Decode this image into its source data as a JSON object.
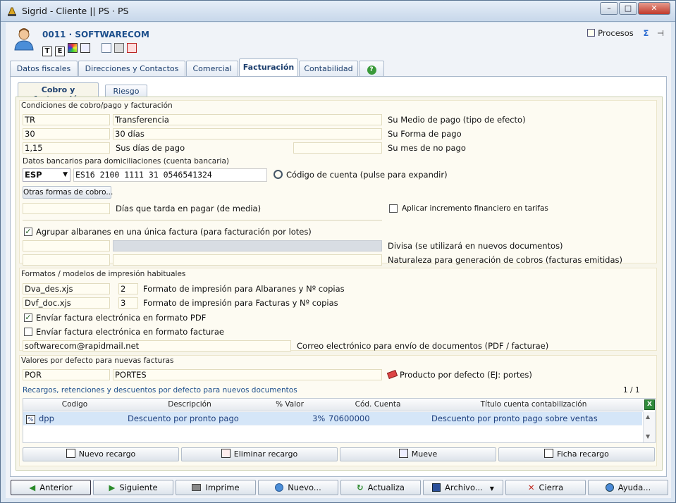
{
  "window": {
    "title": "Sigrid - Cliente || PS · PS",
    "minimize": "–",
    "maximize": "□",
    "close": "✕"
  },
  "header": {
    "client_title": "0011 · SOFTWARECOM",
    "toolbar_icons": [
      "T",
      "E"
    ],
    "procesos_label": "Procesos"
  },
  "tabs": [
    "Datos fiscales",
    "Direcciones y Contactos",
    "Comercial",
    "Facturación",
    "Contabilidad"
  ],
  "subtabs": [
    "Cobro y facturación",
    "Riesgo"
  ],
  "cobro": {
    "section_title": "Condiciones de cobro/pago y facturación",
    "medio_code": "TR",
    "medio_desc": "Transferencia",
    "medio_label": "Su Medio de pago (tipo de efecto)",
    "forma_code": "30",
    "forma_desc": "30 días",
    "forma_label": "Su Forma de pago",
    "dias_value": "1,15",
    "dias_label": "Sus días de pago",
    "mes_no_pago_value": "",
    "mes_no_pago_label": "Su mes de no pago",
    "bank_section": "Datos bancarios para domiciliaciones (cuenta bancaria)",
    "country": "ESP",
    "iban": "ES16 2100 1111 31 0546541324",
    "codigo_cuenta_label": "Código de cuenta (pulse para expandir)",
    "otras_formas_button": "Otras formas de cobro...",
    "dias_tarda_value": "",
    "dias_tarda_label": "Días que tarda en pagar (de media)",
    "incremento_label": "Aplicar incremento financiero en tarifas",
    "agrupar_label": "Agrupar albaranes en una única factura (para facturación por lotes)",
    "divisa_label": "Divisa (se utilizará en nuevos documentos)",
    "naturaleza_label": "Naturaleza para generación de cobros (facturas emitidas)"
  },
  "formatos": {
    "section_title": "Formatos / modelos de impresión habituales",
    "albaranes_file": "Dva_des.xjs",
    "albaranes_copies": "2",
    "albaranes_label": "Formato de impresión para Albaranes y Nº copias",
    "facturas_file": "Dvf_doc.xjs",
    "facturas_copies": "3",
    "facturas_label": "Formato de impresión para Facturas y Nº copias",
    "pdf_label": "Envíar factura electrónica en formato PDF",
    "facturae_label": "Envíar factura electrónica en formato facturae",
    "email": "softwarecom@rapidmail.net",
    "email_label": "Correo electrónico para envío de documentos (PDF / facturae)"
  },
  "valores": {
    "section_title": "Valores por defecto para nuevas facturas",
    "producto_code": "POR",
    "producto_desc": "PORTES",
    "producto_label": "Producto por defecto (EJ: portes)",
    "recargos_title": "Recargos, retenciones y descuentos por defecto para nuevos documentos",
    "pager": "1 / 1",
    "columns": [
      "Codigo",
      "Descripción",
      "% Valor",
      "Cód. Cuenta",
      "Título cuenta contabilización"
    ],
    "rows": [
      {
        "codigo": "dpp",
        "descripcion": "Descuento por pronto pago",
        "valor": "3%",
        "cuenta": "70600000",
        "titulo": "Descuento por pronto pago sobre ventas"
      }
    ],
    "buttons": [
      "Nuevo recargo",
      "Eliminar recargo",
      "Mueve",
      "Ficha recargo"
    ]
  },
  "bottom": [
    "Anterior",
    "Siguiente",
    "Imprime",
    "Nuevo...",
    "Actualiza",
    "Archivo...",
    "Cierra",
    "Ayuda..."
  ],
  "colors": {
    "accent": "#1d4f8c",
    "field_bg": "#fffdf2",
    "selected_row": "#d5e6f8"
  }
}
